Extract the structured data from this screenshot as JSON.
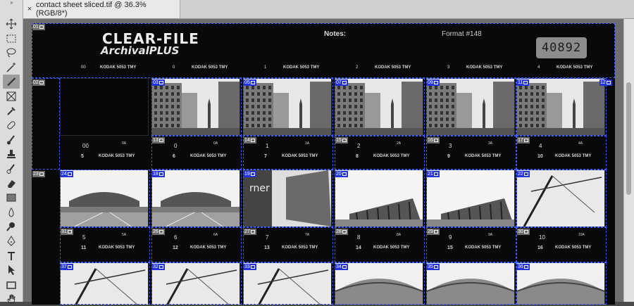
{
  "tab": {
    "close": "×",
    "title": "contact sheet sliced.tif @ 36.3% (RGB/8*)"
  },
  "tools": [
    "move",
    "marquee",
    "lasso",
    "magic-wand",
    "slice",
    "crop",
    "eyedropper",
    "healing",
    "brush",
    "stamp",
    "history-brush",
    "eraser",
    "gradient",
    "blur",
    "dodge",
    "pen",
    "type",
    "path-select",
    "rectangle",
    "hand"
  ],
  "sheet": {
    "logo_line1": "CLEAR-FILE",
    "logo_line2": "ArchivalPLUS",
    "notes": "Notes:",
    "format": "Format #148",
    "stamp": "40892"
  },
  "top_row": [
    {
      "num": "00",
      "label": "KODAK 5053 TMY"
    },
    {
      "num": "0",
      "label": "KODAK 5053 TMY"
    },
    {
      "num": "1",
      "label": "KODAK 5053 TMY"
    },
    {
      "num": "2",
      "label": "KODAK 5053 TMY"
    },
    {
      "num": "3",
      "label": "KODAK 5053 TMY"
    },
    {
      "num": "4",
      "label": "KODAK 5053 TMY"
    }
  ],
  "strip1": {
    "frames": [
      {
        "num": "00",
        "arrow": "0A",
        "cap": "5",
        "label": "KODAK 5053 TMY"
      },
      {
        "num": "0",
        "arrow": "0A",
        "cap": "6",
        "label": "KODAK 5053 TMY"
      },
      {
        "num": "1",
        "arrow": "1A",
        "cap": "7",
        "label": "KODAK 5053 TMY"
      },
      {
        "num": "2",
        "arrow": "2A",
        "cap": "8",
        "label": "KODAK 5053 TMY"
      },
      {
        "num": "3",
        "arrow": "3A",
        "cap": "9",
        "label": "KODAK 5053 TMY"
      },
      {
        "num": "4",
        "arrow": "4A",
        "cap": "10",
        "label": "KODAK 5053 TMY"
      }
    ]
  },
  "strip2": {
    "frames": [
      {
        "num": "5",
        "arrow": "5A",
        "cap": "11",
        "label": "KODAK 5053 TMY"
      },
      {
        "num": "6",
        "arrow": "6A",
        "cap": "12",
        "label": "KODAK 5053 TMY"
      },
      {
        "num": "7",
        "arrow": "7A",
        "cap": "13",
        "label": "KODAK 5053 TMY"
      },
      {
        "num": "8",
        "arrow": "8A",
        "cap": "14",
        "label": "KODAK 5053 TMY"
      },
      {
        "num": "9",
        "arrow": "9A",
        "cap": "15",
        "label": "KODAK 5053 TMY"
      },
      {
        "num": "10",
        "arrow": "10A",
        "cap": "16",
        "label": "KODAK 5053 TMY"
      }
    ]
  },
  "slices": {
    "row0": [
      "01"
    ],
    "row1_left": "02",
    "row1": [
      "03",
      "05",
      "07",
      "09",
      "11"
    ],
    "row1_right": "12",
    "row1_bottom": [
      "13",
      "14",
      "15",
      "16",
      "17"
    ],
    "row2_left": "23",
    "row2": [
      "24",
      "18",
      "19",
      "20",
      "21",
      "22"
    ],
    "row2_bottom": [
      "31",
      "26",
      "27",
      "28",
      "29",
      "30"
    ],
    "row3": [
      "37",
      "32",
      "33",
      "34",
      "35",
      "36"
    ]
  },
  "colors": {
    "slice_guide": "#3a5cff",
    "slice_label": "#2233dd",
    "panel": "#dcdcdc",
    "canvas": "#6f6f6f"
  }
}
